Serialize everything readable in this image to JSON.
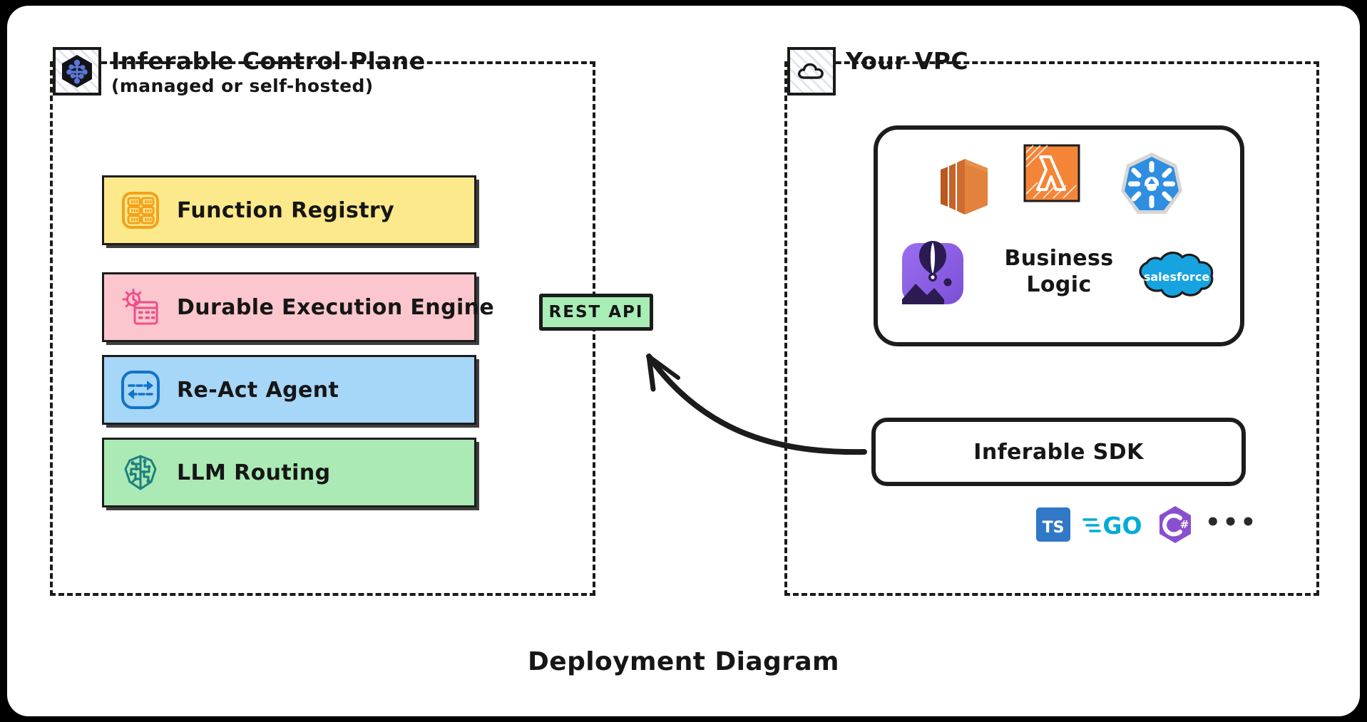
{
  "caption": "Deployment Diagram",
  "zones": {
    "control_plane": {
      "icon": "inferable-hexagon-logo-icon",
      "title": "Inferable Control Plane",
      "subtitle": "(managed or self-hosted)",
      "components": [
        {
          "id": "registry",
          "label": "Function Registry",
          "icon": "grid-registry-icon",
          "color": "#fce98b",
          "icon_color": "#f5a11b"
        },
        {
          "id": "durable",
          "label": "Durable Execution Engine",
          "icon": "clock-calendar-icon",
          "color": "#fbc6cd",
          "icon_color": "#ef4d8b"
        },
        {
          "id": "react",
          "label": "Re-Act Agent",
          "icon": "two-way-arrows-icon",
          "color": "#a6d6f8",
          "icon_color": "#1273c7"
        },
        {
          "id": "llm",
          "label": "LLM Routing",
          "icon": "circuit-brain-icon",
          "color": "#abeab4",
          "icon_color": "#1e7f7f"
        }
      ]
    },
    "vpc": {
      "icon": "cloud-icon",
      "title": "Your VPC",
      "business_logic": {
        "label_line1": "Business",
        "label_line2": "Logic",
        "logos": [
          {
            "name": "aws-ecs-icon",
            "label": "AWS",
            "color": "#e2762a"
          },
          {
            "name": "aws-lambda-icon",
            "label": "Lambda",
            "color": "#f58536"
          },
          {
            "name": "kubernetes-icon",
            "label": "Kubernetes",
            "color": "#2f8ee0"
          },
          {
            "name": "balloon-app-icon",
            "label": "Balloon",
            "color": "#8b5cf6"
          },
          {
            "name": "salesforce-icon",
            "label": "salesforce",
            "color": "#17a3e0"
          }
        ]
      },
      "sdk": {
        "label": "Inferable SDK",
        "languages": [
          {
            "name": "typescript-icon",
            "label": "TS",
            "color": "#3178c6"
          },
          {
            "name": "golang-icon",
            "label": "GO",
            "color": "#00acd7"
          },
          {
            "name": "csharp-icon",
            "label": "C#",
            "color": "#8a4fcf"
          }
        ],
        "more": "•••"
      }
    }
  },
  "connector": {
    "label": "REST API",
    "color": "#a8ecb6",
    "direction": "sdk-to-rest-api"
  }
}
